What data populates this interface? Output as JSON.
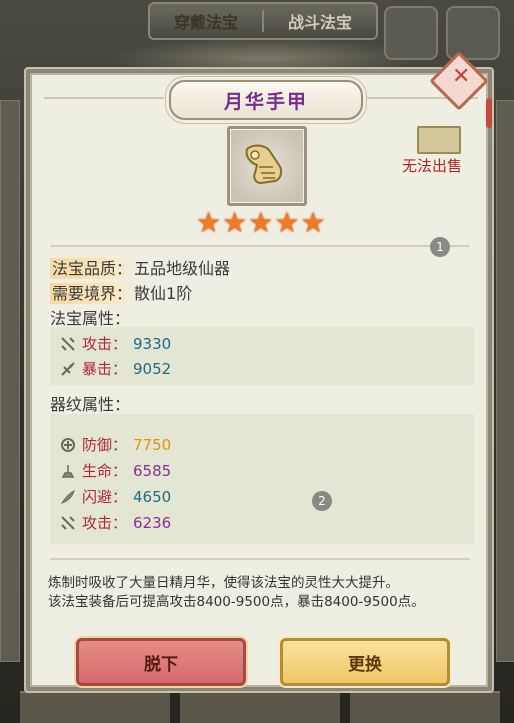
{
  "background": {
    "tabs": [
      "穿戴法宝",
      "战斗法宝"
    ]
  },
  "dialog": {
    "title": "月华手甲",
    "close_icon": "close-icon",
    "no_sell_label": "无法出售",
    "star_count": 5,
    "badges": [
      "1",
      "2"
    ],
    "quality": {
      "label": "法宝品质：",
      "value": "五品地级仙器"
    },
    "realm": {
      "label": "需要境界：",
      "value": "散仙1阶"
    },
    "attr_section_label": "法宝属性：",
    "attributes": [
      {
        "icon": "crossbow-icon",
        "name": "攻击：",
        "value": "9330",
        "color": "#1e6a88"
      },
      {
        "icon": "crossbow-crit-icon",
        "name": "暴击：",
        "value": "9052",
        "color": "#1e6a88"
      }
    ],
    "pattern_section_label": "器纹属性：",
    "patterns": [
      {
        "icon": "shield-knot-icon",
        "name": "防御：",
        "value": "7750",
        "color": "#e0940c"
      },
      {
        "icon": "fountain-icon",
        "name": "生命：",
        "value": "6585",
        "color": "#8c2f95"
      },
      {
        "icon": "feather-icon",
        "name": "闪避：",
        "value": "4650",
        "color": "#1e6a88"
      },
      {
        "icon": "crossbow-icon",
        "name": "攻击：",
        "value": "6236",
        "color": "#8c2f95"
      }
    ],
    "description_line1": "炼制时吸收了大量日精月华，使得该法宝的灵性大大提升。",
    "description_line2": "该法宝装备后可提高攻击8400-9500点，暴击8400-9500点。",
    "unequip_label": "脱下",
    "replace_label": "更换"
  }
}
